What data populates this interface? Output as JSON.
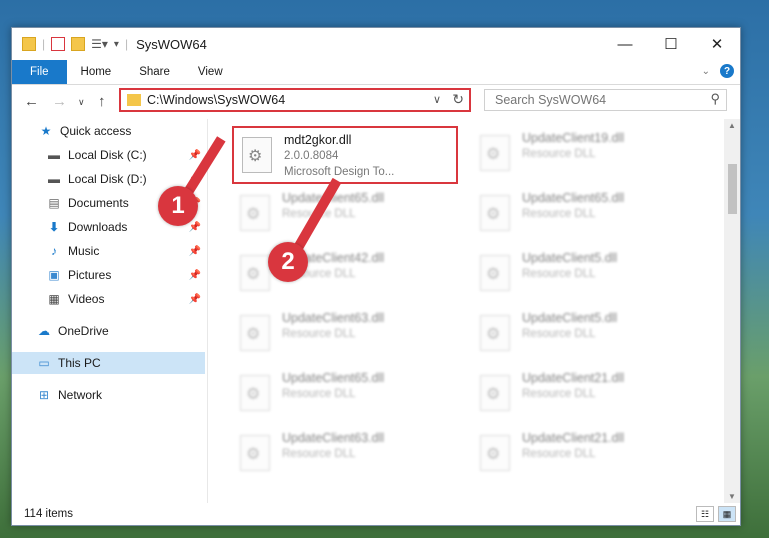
{
  "window": {
    "title": "SysWOW64"
  },
  "ribbon": {
    "tabs": [
      "File",
      "Home",
      "Share",
      "View"
    ]
  },
  "address": {
    "path": "C:\\Windows\\SysWOW64"
  },
  "search": {
    "placeholder": "Search SysWOW64"
  },
  "nav": {
    "items": [
      {
        "label": "Quick access",
        "icon": "star-icon"
      },
      {
        "label": "Local Disk (C:)",
        "icon": "drive-icon",
        "pinned": true
      },
      {
        "label": "Local Disk (D:)",
        "icon": "drive-icon",
        "pinned": true
      },
      {
        "label": "Documents",
        "icon": "documents-icon",
        "pinned": true
      },
      {
        "label": "Downloads",
        "icon": "download-icon",
        "pinned": true
      },
      {
        "label": "Music",
        "icon": "music-icon",
        "pinned": true
      },
      {
        "label": "Pictures",
        "icon": "pictures-icon",
        "pinned": true
      },
      {
        "label": "Videos",
        "icon": "videos-icon",
        "pinned": true
      },
      {
        "label": "OneDrive",
        "icon": "cloud-icon"
      },
      {
        "label": "This PC",
        "icon": "computer-icon",
        "selected": true
      },
      {
        "label": "Network",
        "icon": "network-icon"
      }
    ]
  },
  "files": {
    "highlighted": {
      "name": "mdt2gkor.dll",
      "version": "2.0.0.8084",
      "company": "Microsoft Design To..."
    },
    "blurred": [
      {
        "name": "UpdateClient19.dll",
        "desc": "Resource DLL"
      },
      {
        "name": "UpdateClient65.dll",
        "desc": "Resource DLL"
      },
      {
        "name": "UpdateClient65.dll",
        "desc": "Resource DLL"
      },
      {
        "name": "UpdateClient42.dll",
        "desc": "Resource DLL"
      },
      {
        "name": "UpdateClient5.dll",
        "desc": "Resource DLL"
      },
      {
        "name": "UpdateClient63.dll",
        "desc": "Resource DLL"
      },
      {
        "name": "UpdateClient5.dll",
        "desc": "Resource DLL"
      },
      {
        "name": "UpdateClient65.dll",
        "desc": "Resource DLL"
      },
      {
        "name": "UpdateClient21.dll",
        "desc": "Resource DLL"
      },
      {
        "name": "UpdateClient63.dll",
        "desc": "Resource DLL"
      },
      {
        "name": "UpdateClient21.dll",
        "desc": "Resource DLL"
      }
    ]
  },
  "status": {
    "item_count": "114 items"
  },
  "callouts": [
    "1",
    "2"
  ],
  "colors": {
    "accent": "#1979ca",
    "highlight": "#d9363e"
  }
}
